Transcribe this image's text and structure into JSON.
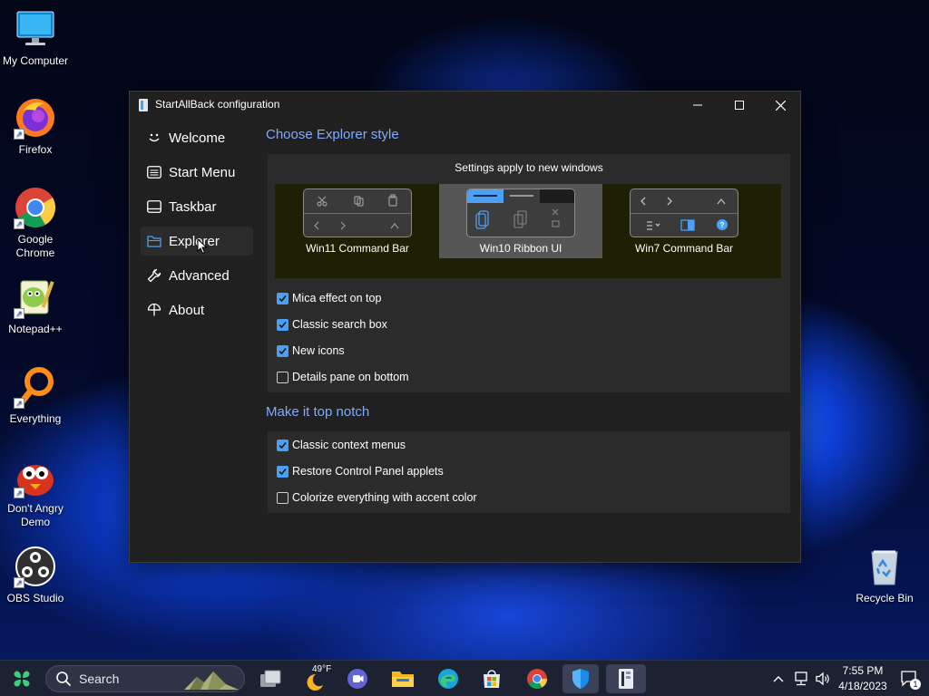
{
  "desktop": {
    "icons": [
      {
        "label": "My Computer"
      },
      {
        "label": "Firefox"
      },
      {
        "label": "Google Chrome"
      },
      {
        "label": "Notepad++"
      },
      {
        "label": "Everything"
      },
      {
        "label": "Don't Angry Demo"
      },
      {
        "label": "OBS Studio"
      },
      {
        "label": "Recycle Bin"
      }
    ]
  },
  "window": {
    "title": "StartAllBack configuration",
    "nav": [
      {
        "label": "Welcome",
        "icon": "smiley-icon"
      },
      {
        "label": "Start Menu",
        "icon": "start-menu-icon"
      },
      {
        "label": "Taskbar",
        "icon": "taskbar-icon"
      },
      {
        "label": "Explorer",
        "icon": "folder-icon"
      },
      {
        "label": "Advanced",
        "icon": "wrench-icon"
      },
      {
        "label": "About",
        "icon": "about-icon"
      }
    ],
    "selected_nav": "Explorer",
    "explorer": {
      "style_title": "Choose Explorer style",
      "settings_note": "Settings apply to new windows",
      "styles": [
        {
          "label": "Win11 Command Bar"
        },
        {
          "label": "Win10 Ribbon UI"
        },
        {
          "label": "Win7 Command Bar"
        }
      ],
      "selected_style": "Win10 Ribbon UI",
      "options": [
        {
          "label": "Mica effect on top",
          "checked": true
        },
        {
          "label": "Classic search box",
          "checked": true
        },
        {
          "label": "New icons",
          "checked": true
        },
        {
          "label": "Details pane on bottom",
          "checked": false
        }
      ],
      "notch_title": "Make it top notch",
      "notch_options": [
        {
          "label": "Classic context menus",
          "checked": true
        },
        {
          "label": "Restore Control Panel applets",
          "checked": true
        },
        {
          "label": "Colorize everything with accent color",
          "checked": false
        }
      ]
    }
  },
  "taskbar": {
    "search_placeholder": "Search",
    "weather": "49°F",
    "time": "7:55 PM",
    "date": "4/18/2023",
    "notification_count": "1"
  },
  "colors": {
    "accent": "#4b9ff5",
    "section_title": "#7eaaff",
    "window_bg": "#202020",
    "panel_bg": "#2b2b2b",
    "style_strip": "#1f1f03"
  }
}
